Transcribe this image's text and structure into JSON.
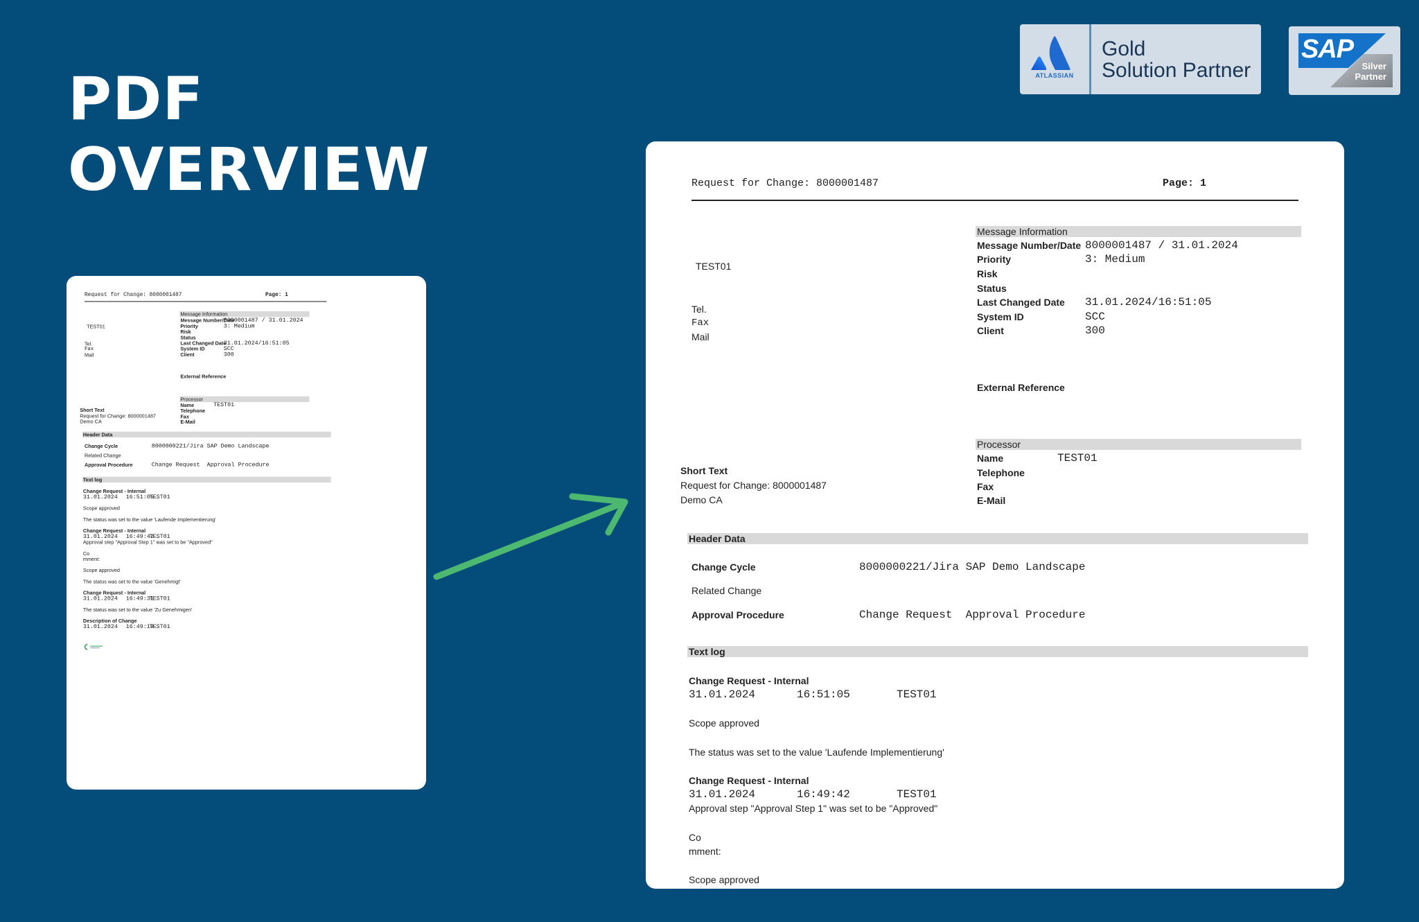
{
  "headline": {
    "line1": "PDF",
    "line2": "OVERVIEW"
  },
  "badges": {
    "atlassian": {
      "brand": "ATLASSIAN",
      "line1": "Gold",
      "line2": "Solution Partner",
      "color": "#1f6ad0"
    },
    "sap": {
      "brand": "SAP",
      "line1": "Silver",
      "line2": "Partner"
    }
  },
  "colors": {
    "background": "#044c79",
    "arrow": "#4cb870",
    "sap_blue": "#1473c8"
  },
  "document": {
    "title": "Request for Change: 8000001487",
    "page": "Page: 1",
    "requester": {
      "name": "TEST01",
      "tel": "Tel.",
      "fax": "Fax",
      "mail": "Mail"
    },
    "message_info": {
      "heading": "Message Information",
      "rows": [
        {
          "label": "Message Number/Date",
          "value": "8000001487 / 31.01.2024"
        },
        {
          "label": "Priority",
          "value": "3: Medium"
        },
        {
          "label": "Risk",
          "value": ""
        },
        {
          "label": "Status",
          "value": ""
        },
        {
          "label": "Last Changed Date",
          "value": "31.01.2024/16:51:05"
        },
        {
          "label": "System ID",
          "value": "SCC"
        },
        {
          "label": "Client",
          "value": "300"
        }
      ]
    },
    "external_reference": "External Reference",
    "processor": {
      "heading": "Processor",
      "rows": [
        {
          "label": "Name",
          "value": "TEST01"
        },
        {
          "label": "Telephone",
          "value": ""
        },
        {
          "label": "Fax",
          "value": ""
        },
        {
          "label": "E-Mail",
          "value": ""
        }
      ]
    },
    "short_text": {
      "label": "Short Text",
      "line1": "Request for Change: 8000001487",
      "line2": "Demo CA"
    },
    "header_data": {
      "heading": "Header Data",
      "rows": [
        {
          "label": "Change Cycle",
          "value": "8000000221/Jira SAP Demo Landscape"
        },
        {
          "label": "Related Change",
          "value": ""
        },
        {
          "label": "Approval Procedure",
          "value": "Change Request  Approval Procedure"
        }
      ]
    },
    "text_log": {
      "heading": "Text log",
      "entries": [
        {
          "type": "Change Request - Internal",
          "date": "31.01.2024",
          "time": "16:51:05",
          "user": "TEST01",
          "extra": ""
        },
        {
          "type": "Change Request - Internal",
          "date": "31.01.2024",
          "time": "16:49:42",
          "user": "TEST01",
          "extra": "Approval step \"Approval Step 1\" was set to be \"Approved\""
        },
        {
          "type": "Change Request - Internal",
          "date": "31.01.2024",
          "time": "16:49:31",
          "user": "TEST01",
          "extra": ""
        },
        {
          "type": "Description of Change",
          "date": "31.01.2024",
          "time": "16:49:19",
          "user": "TEST01",
          "extra": ""
        }
      ],
      "lines": {
        "scope_approved": "Scope approved",
        "status_laufende": "The status was set to the value 'Laufende Implementierung'",
        "co": "Co",
        "mment": "mment:",
        "status_genehmigt": "The status was set to the value 'Genehmigt'",
        "status_zu_genehmigen": "The status was set to the value 'Zu Genehmigen'"
      }
    }
  }
}
